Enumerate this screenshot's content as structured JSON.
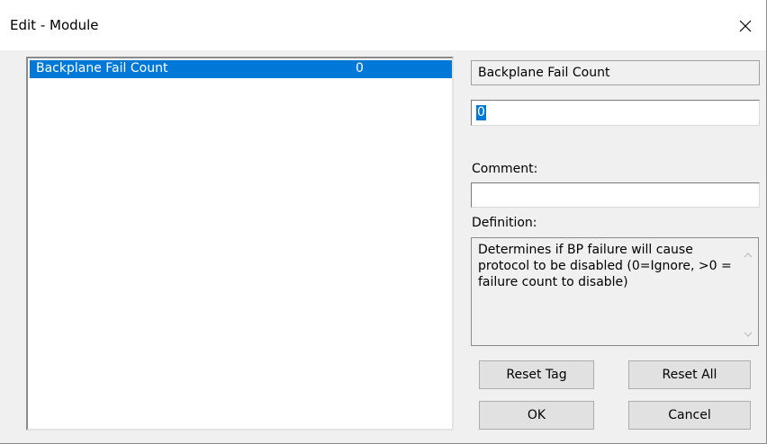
{
  "window": {
    "title": "Edit - Module",
    "close_icon": "close-icon"
  },
  "list": {
    "items": [
      {
        "name": "Backplane Fail Count",
        "value": "0",
        "selected": true
      }
    ]
  },
  "editor": {
    "tag_name": "Backplane Fail Count",
    "value": "0",
    "comment_label": "Comment:",
    "comment_value": "",
    "definition_label": "Definition:",
    "definition_text": "Determines if BP failure will cause protocol to be disabled (0=Ignore, >0 = failure count to disable)"
  },
  "buttons": {
    "reset_tag": "Reset Tag",
    "reset_all": "Reset All",
    "ok": "OK",
    "cancel": "Cancel"
  },
  "colors": {
    "selection": "#0078d7",
    "dialog_bg": "#f0f0f0",
    "title_bg": "#ffffff"
  }
}
